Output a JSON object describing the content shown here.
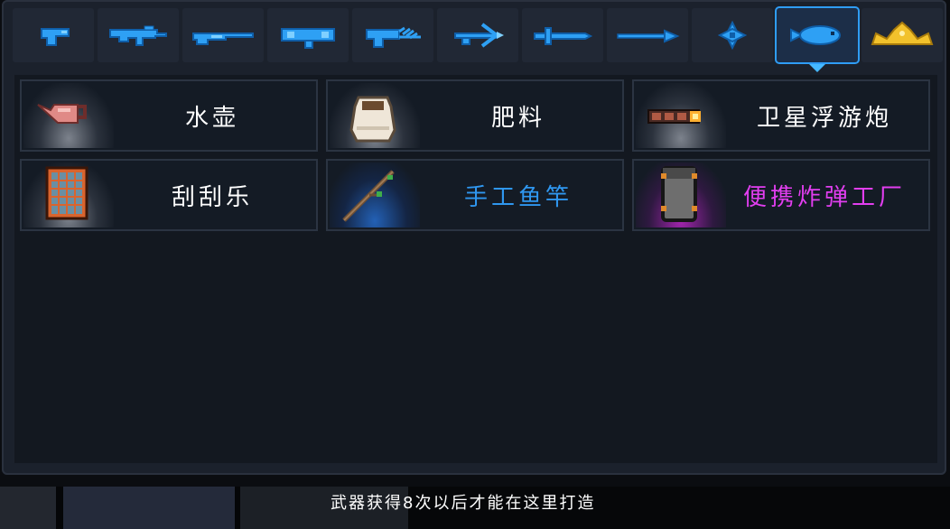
{
  "tabs": [
    {
      "icon": "pistol-icon",
      "selected": false
    },
    {
      "icon": "assault-rifle-icon",
      "selected": false
    },
    {
      "icon": "shotgun-icon",
      "selected": false
    },
    {
      "icon": "rocket-launcher-icon",
      "selected": false
    },
    {
      "icon": "laser-gun-icon",
      "selected": false
    },
    {
      "icon": "crossbow-icon",
      "selected": false
    },
    {
      "icon": "sword-icon",
      "selected": false
    },
    {
      "icon": "spear-icon",
      "selected": false
    },
    {
      "icon": "shuriken-icon",
      "selected": false
    },
    {
      "icon": "fish-icon",
      "selected": true
    },
    {
      "icon": "crown-icon",
      "selected": false
    }
  ],
  "items": [
    {
      "name": "水壶",
      "icon": "watering-can-icon",
      "rarity": "common"
    },
    {
      "name": "肥料",
      "icon": "fertilizer-bag-icon",
      "rarity": "common"
    },
    {
      "name": "卫星浮游炮",
      "icon": "satellite-cannon-icon",
      "rarity": "common"
    },
    {
      "name": "刮刮乐",
      "icon": "scratch-card-icon",
      "rarity": "common"
    },
    {
      "name": "手工鱼竿",
      "icon": "fishing-rod-icon",
      "rarity": "rare"
    },
    {
      "name": "便携炸弹工厂",
      "icon": "bomb-factory-icon",
      "rarity": "epic"
    }
  ],
  "footer": {
    "hint": "武器获得8次以后才能在这里打造"
  },
  "colors": {
    "accent": "#2f9df5",
    "rare_text": "#2f97f0",
    "epic_text": "#e23ef0",
    "panel": "#1b212c"
  }
}
